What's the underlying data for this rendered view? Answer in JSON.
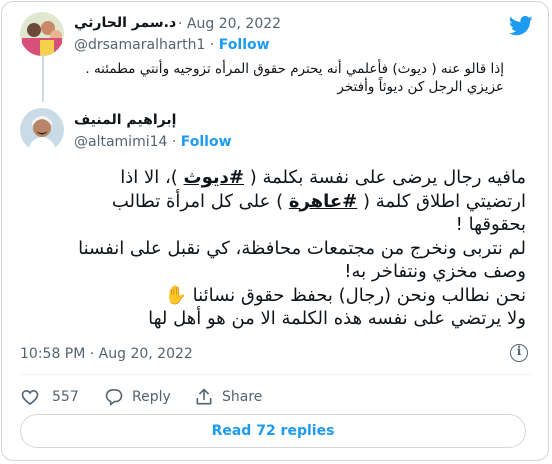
{
  "quoted_tweet": {
    "display_name": "د.سمر الحارثي",
    "handle": "@drsamaralharth1",
    "separator": "·",
    "date": "Aug 20, 2022",
    "follow_label": "Follow",
    "text_lines": [
      "إذا قالو عنه ( ديوث) فأعلمي أنه يحترم حقوق المرأه تزوجيه وأنتي مطمئنه .",
      "عزيزي الرجل كن ديوثاً وأفتخر"
    ]
  },
  "main_tweet": {
    "display_name": "إبراهيم المنيف",
    "handle": "@altamimi14",
    "separator": "·",
    "follow_label": "Follow",
    "line1_pre": "مافيه رجال يرضى على نفسة بكلمة ( ",
    "hashtag1": "#ديوث",
    "line1_post": " )، الا اذا",
    "line2_pre": "ارتضيتي اطلاق كلمة ( ",
    "hashtag2": "#عاهرة",
    "line2_post": " ) على كل امرأة تطالب",
    "line3": "بحقوقها !",
    "line4": "لم نتربى ونخرج من مجتمعات محافظة، كي نقبل على انفسنا",
    "line5": "وصف مخزي ونتفاخر به!",
    "line6_text": "نحن نطالب ونحن (رجال) بحفظ حقوق نسائنا",
    "line6_emoji": "✋",
    "line7": "ولا يرتضي على نفسه هذه الكلمة الا من هو أهل لها",
    "timestamp": "10:58 PM · Aug 20, 2022"
  },
  "actions": {
    "like_count": "557",
    "reply_label": "Reply",
    "share_label": "Share"
  },
  "read_replies_label": "Read 72 replies",
  "icons": [
    "twitter-bird-icon",
    "heart-icon",
    "reply-icon",
    "share-icon",
    "info-icon"
  ],
  "colors": {
    "accent": "#1d9bf0",
    "text": "#0f1419",
    "muted": "#536471",
    "border": "#cfd9de"
  }
}
